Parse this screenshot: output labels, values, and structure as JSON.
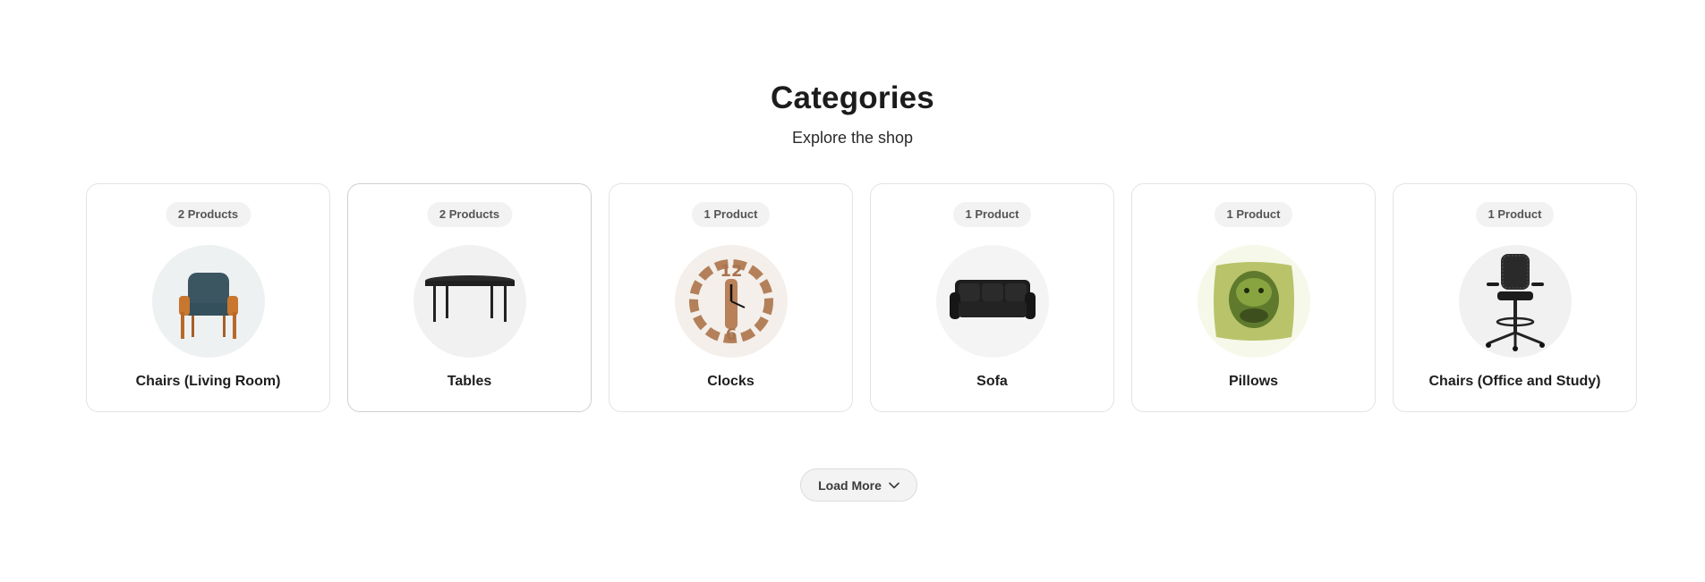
{
  "section": {
    "title": "Categories",
    "subtitle": "Explore the shop"
  },
  "categories": [
    {
      "badge": "2 Products",
      "name": "Chairs (Living Room)",
      "image_icon": "armchair-icon",
      "bg": "#eef1f2"
    },
    {
      "badge": "2 Products",
      "name": "Tables",
      "image_icon": "table-icon",
      "bg": "#f1f1f1"
    },
    {
      "badge": "1 Product",
      "name": "Clocks",
      "image_icon": "clock-icon",
      "bg": "#f4efea"
    },
    {
      "badge": "1 Product",
      "name": "Sofa",
      "image_icon": "sofa-icon",
      "bg": "#f5f4f4"
    },
    {
      "badge": "1 Product",
      "name": "Pillows",
      "image_icon": "pillow-icon",
      "bg": "#f6f8e9"
    },
    {
      "badge": "1 Product",
      "name": "Chairs (Office and Study)",
      "image_icon": "office-chair-icon",
      "bg": "#f1f1f2"
    }
  ],
  "load_more": {
    "label": "Load More",
    "icon": "chevron-down-icon"
  }
}
